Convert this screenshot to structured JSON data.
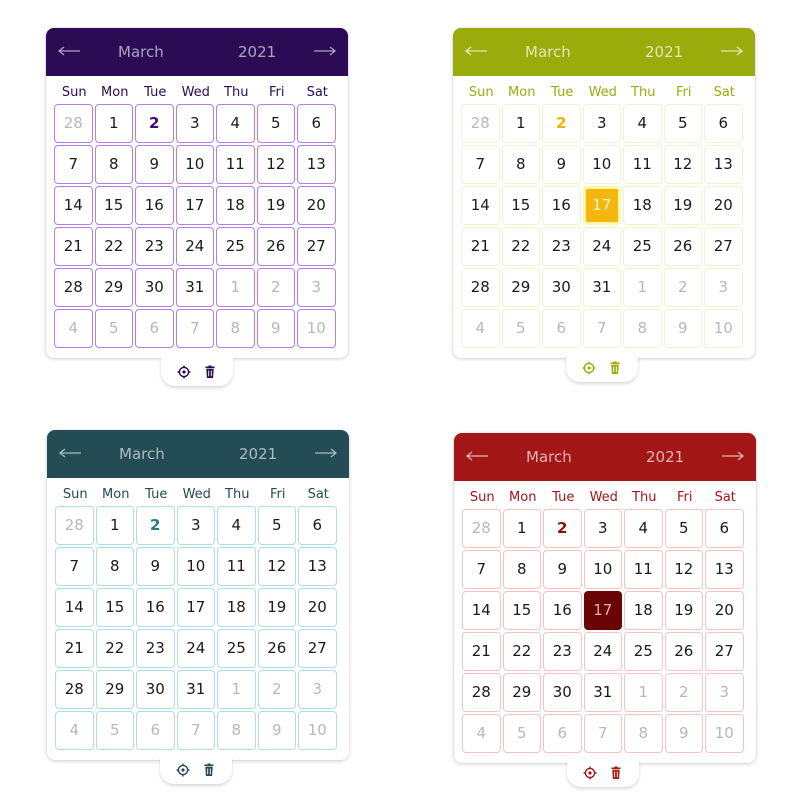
{
  "weekdays": [
    "Sun",
    "Mon",
    "Tue",
    "Wed",
    "Thu",
    "Fri",
    "Sat"
  ],
  "days": [
    {
      "label": "28",
      "muted": true
    },
    {
      "label": "1",
      "muted": false
    },
    {
      "label": "2",
      "muted": false,
      "today": true
    },
    {
      "label": "3",
      "muted": false
    },
    {
      "label": "4",
      "muted": false
    },
    {
      "label": "5",
      "muted": false
    },
    {
      "label": "6",
      "muted": false
    },
    {
      "label": "7",
      "muted": false
    },
    {
      "label": "8",
      "muted": false
    },
    {
      "label": "9",
      "muted": false
    },
    {
      "label": "10",
      "muted": false
    },
    {
      "label": "11",
      "muted": false
    },
    {
      "label": "12",
      "muted": false
    },
    {
      "label": "13",
      "muted": false
    },
    {
      "label": "14",
      "muted": false
    },
    {
      "label": "15",
      "muted": false
    },
    {
      "label": "16",
      "muted": false
    },
    {
      "label": "17",
      "muted": false
    },
    {
      "label": "18",
      "muted": false
    },
    {
      "label": "19",
      "muted": false
    },
    {
      "label": "20",
      "muted": false
    },
    {
      "label": "21",
      "muted": false
    },
    {
      "label": "22",
      "muted": false
    },
    {
      "label": "23",
      "muted": false
    },
    {
      "label": "24",
      "muted": false
    },
    {
      "label": "25",
      "muted": false
    },
    {
      "label": "26",
      "muted": false
    },
    {
      "label": "27",
      "muted": false
    },
    {
      "label": "28",
      "muted": false
    },
    {
      "label": "29",
      "muted": false
    },
    {
      "label": "30",
      "muted": false
    },
    {
      "label": "31",
      "muted": false
    },
    {
      "label": "1",
      "muted": true
    },
    {
      "label": "2",
      "muted": true
    },
    {
      "label": "3",
      "muted": true
    },
    {
      "label": "4",
      "muted": true
    },
    {
      "label": "5",
      "muted": true
    },
    {
      "label": "6",
      "muted": true
    },
    {
      "label": "7",
      "muted": true
    },
    {
      "label": "8",
      "muted": true
    },
    {
      "label": "9",
      "muted": true
    },
    {
      "label": "10",
      "muted": true
    }
  ],
  "calendars": [
    {
      "theme": "purple",
      "month": "March",
      "year": "2021",
      "accent": "#2a0b54",
      "selected_day": null
    },
    {
      "theme": "olive",
      "month": "March",
      "year": "2021",
      "accent": "#9aab0c",
      "selected_day": "17"
    },
    {
      "theme": "teal",
      "month": "March",
      "year": "2021",
      "accent": "#234c55",
      "selected_day": null
    },
    {
      "theme": "red",
      "month": "March",
      "year": "2021",
      "accent": "#a31616",
      "selected_day": "17"
    }
  ],
  "footer_icons": [
    "target-icon",
    "trash-icon"
  ]
}
